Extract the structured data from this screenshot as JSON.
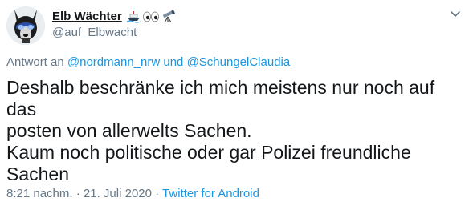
{
  "user": {
    "display_name": "Elb Wächter",
    "handle": "@auf_Elbwacht",
    "name_emojis": [
      "ship-icon",
      "eyes-icon",
      "telescope-icon"
    ],
    "avatar": "dog-avatar"
  },
  "reply": {
    "prefix": "Antwort an",
    "user1": "@nordmann_nrw",
    "conjunction": "und",
    "user2": "@SchungelClaudia"
  },
  "tweet": {
    "text": "Deshalb beschränke ich mich meistens nur noch auf das\nposten von allerwelts Sachen.\nKaum noch politische oder gar Polizei freundliche\nSachen"
  },
  "meta": {
    "time": "8:21 nachm.",
    "separator": "·",
    "date": "21. Juli 2020",
    "source": "Twitter for Android"
  },
  "menu": {
    "icon": "chevron-down-icon"
  }
}
